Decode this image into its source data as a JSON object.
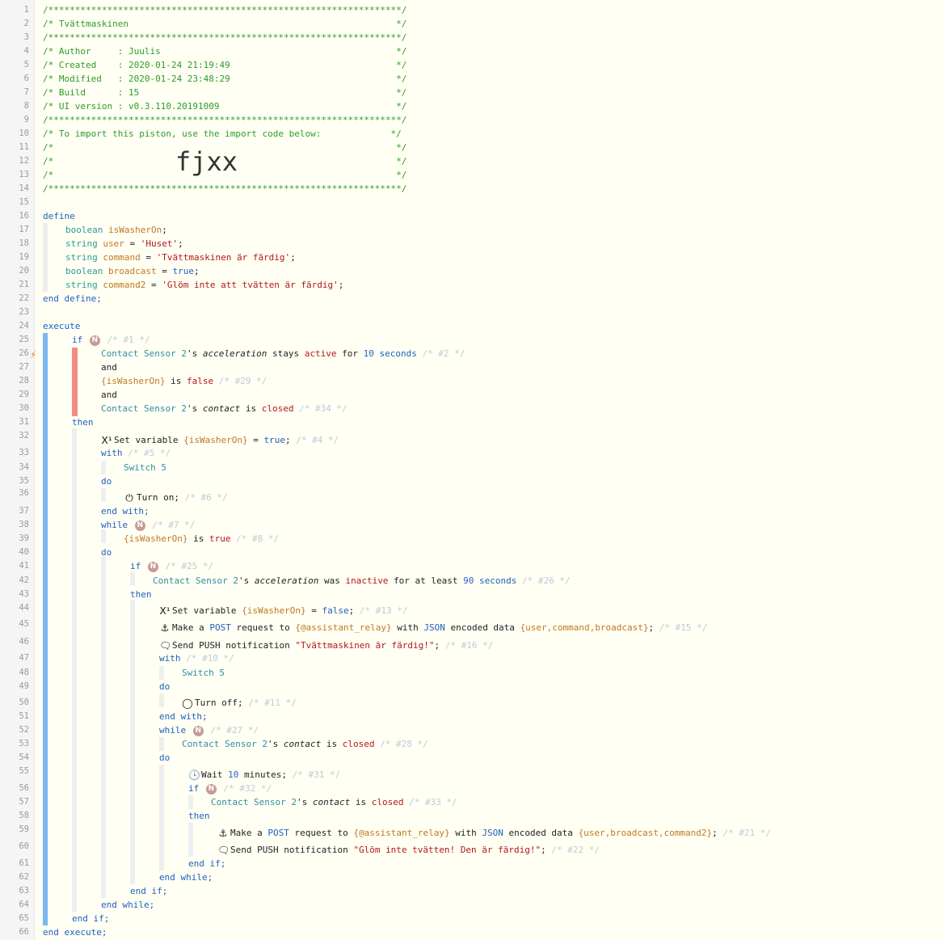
{
  "editor": {
    "import_code": "fjxx",
    "colors": {
      "keyword": "#1f5fbf",
      "comment": "#2e9c28",
      "string": "#b51717",
      "variable": "#c0781e",
      "type": "#2a9d8f",
      "condition_bar": "#f28b82",
      "block_bar": "#7ab8f0",
      "badge": "#c79a9a"
    },
    "header_lines": {
      "l1": "/******************************************************************/",
      "l2": "/* Tvättmaskinen                                                  */",
      "l3": "/******************************************************************/",
      "l4": "/* Author     : Juulis                                            */",
      "l5": "/* Created    : 2020-01-24 21:19:49                               */",
      "l6": "/* Modified   : 2020-01-24 23:48:29                               */",
      "l7": "/* Build      : 15                                                */",
      "l8": "/* UI version : v0.3.110.20191009                                 */",
      "l9": "/******************************************************************/",
      "l10": "/* To import this piston, use the import code below:             */",
      "l11": "/*                                                                */",
      "l12": "/*                                                                */",
      "l13": "/*                                                                */",
      "l14": "/******************************************************************/"
    },
    "kw": {
      "define": "define",
      "end_define": "end define;",
      "execute": "execute",
      "end_execute": "end execute;",
      "if": "if",
      "then": "then",
      "and": "and",
      "with": "with",
      "do": "do",
      "end_with": "end with;",
      "while": "while",
      "end_while": "end while;",
      "end_if": "end if;",
      "boolean": "boolean",
      "string": "string",
      "is": "is",
      "stays": "stays",
      "for": "for",
      "was": "was",
      "for_at_least": "for at least",
      "seconds": "seconds",
      "minutes": "minutes;",
      "eq": "=",
      "true": "true",
      "false": "false",
      "s_apos": "'s",
      "set_variable": "Set variable",
      "make_a": "Make a",
      "request_to": "request to",
      "with2": "with",
      "encoded_data": "encoded data",
      "send_push": "Send PUSH notification",
      "wait": "Wait",
      "turn_on": "Turn on;",
      "turn_off": "Turn off;",
      "semi": ";",
      "post": "POST",
      "json": "JSON",
      "active": "active",
      "inactive": "inactive",
      "closed": "closed"
    },
    "badge_label": "N",
    "vars": {
      "isWasherOn": "isWasherOn",
      "user": "user",
      "command": "command",
      "broadcast": "broadcast",
      "command2": "command2",
      "isWasherOn_b": "{isWasherOn}",
      "assistant_relay": "{@assistant_relay}",
      "data1": "{user,command,broadcast}",
      "data2": "{user,broadcast,command2}"
    },
    "strings": {
      "user_val": "'Huset'",
      "command_val": "'Tvättmaskinen är färdig'",
      "command2_val": "'Glöm inte att tvätten är färdig'",
      "push1": "\"Tvättmaskinen är färdig!\"",
      "push2": "\"Glöm inte tvätten! Den är färdig!\""
    },
    "devices": {
      "contact": "Contact Sensor 2",
      "switch": "Switch 5"
    },
    "attrs": {
      "acceleration": "acceleration",
      "contact": "contact"
    },
    "nums": {
      "n10": "10",
      "n90": "90"
    },
    "comments": {
      "c1": "/* #1 */",
      "c2": "/* #2 */",
      "c29": "/* #29 */",
      "c34": "/* #34 */",
      "c4": "/* #4 */",
      "c5": "/* #5 */",
      "c6": "/* #6 */",
      "c7": "/* #7 */",
      "c8": "/* #8 */",
      "c25": "/* #25 */",
      "c26": "/* #26 */",
      "c13": "/* #13 */",
      "c15": "/* #15 */",
      "c16": "/* #16 */",
      "c10": "/* #10 */",
      "c11": "/* #11 */",
      "c27": "/* #27 */",
      "c28": "/* #28 */",
      "c31": "/* #31 */",
      "c32": "/* #32 */",
      "c33": "/* #33 */",
      "c21": "/* #21 */",
      "c22": "/* #22 */"
    },
    "icons": {
      "set": "X¹",
      "anchor": "⚓",
      "bubble": "🗨",
      "power_on": "⏻",
      "power_off": "◯",
      "clock": "🕓",
      "bolt": "⚡"
    },
    "line_numbers": [
      "1",
      "2",
      "3",
      "4",
      "5",
      "6",
      "7",
      "8",
      "9",
      "10",
      "11",
      "12",
      "13",
      "14",
      "15",
      "16",
      "17",
      "18",
      "19",
      "20",
      "21",
      "22",
      "23",
      "24",
      "25",
      "26",
      "27",
      "28",
      "29",
      "30",
      "31",
      "32",
      "33",
      "34",
      "35",
      "36",
      "37",
      "38",
      "39",
      "40",
      "41",
      "42",
      "43",
      "44",
      "45",
      "46",
      "47",
      "48",
      "49",
      "50",
      "51",
      "52",
      "53",
      "54",
      "55",
      "56",
      "57",
      "58",
      "59",
      "60",
      "61",
      "62",
      "63",
      "64",
      "65",
      "66"
    ]
  }
}
